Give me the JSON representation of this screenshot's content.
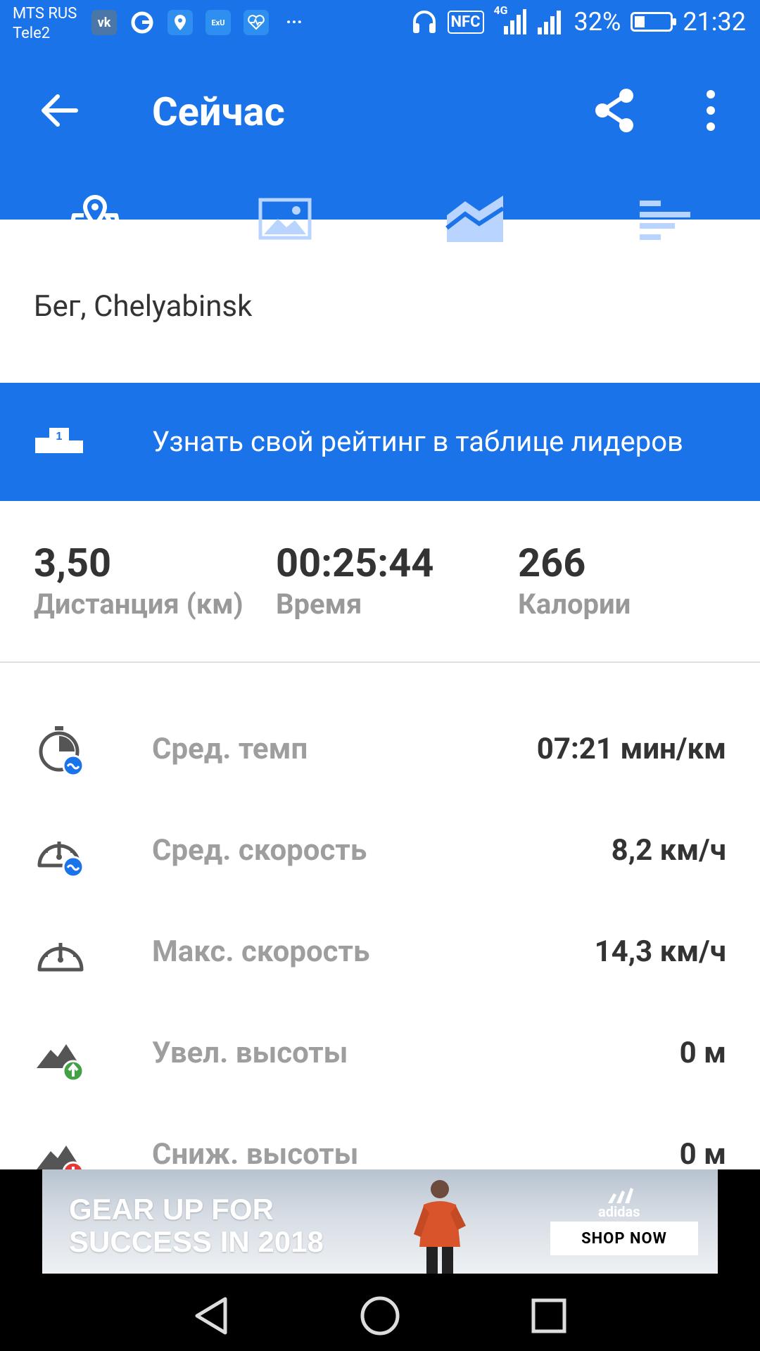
{
  "status_bar": {
    "carrier_1": "MTS RUS",
    "carrier_2": "Tele2",
    "net_type": "4G",
    "nfc": "NFC",
    "battery_pct": "32%",
    "battery_level": 0.32,
    "time": "21:32",
    "app_icons": [
      "vk-icon",
      "google-icon",
      "maps-pin-icon",
      "app-icon",
      "health-icon",
      "more-dots-icon"
    ]
  },
  "app_bar": {
    "title": "Сейчас",
    "tabs": [
      {
        "name": "map",
        "icon": "map-icon",
        "active": true
      },
      {
        "name": "photos",
        "icon": "image-icon",
        "active": false
      },
      {
        "name": "charts",
        "icon": "chart-icon",
        "active": false
      },
      {
        "name": "splits",
        "icon": "splits-icon",
        "active": false
      }
    ]
  },
  "activity": {
    "location": "Бег, Chelyabinsk"
  },
  "leaderboard": {
    "badge_number": "1",
    "text": "Узнать свой рейтинг в таблице лидеров"
  },
  "summary": {
    "distance": {
      "value": "3,50",
      "label": "Дистанция (км)"
    },
    "time": {
      "value": "00:25:44",
      "label": "Время"
    },
    "calories": {
      "value": "266",
      "label": "Калории"
    }
  },
  "metrics": [
    {
      "label": "Сред. темп",
      "value": "07:21 мин/км",
      "icon": "avg-pace-icon"
    },
    {
      "label": "Сред. скорость",
      "value": "8,2 км/ч",
      "icon": "avg-speed-icon"
    },
    {
      "label": "Макс. скорость",
      "value": "14,3 км/ч",
      "icon": "max-speed-icon"
    },
    {
      "label": "Увел. высоты",
      "value": "0 м",
      "icon": "elevation-gain-icon"
    },
    {
      "label": "Сниж. высоты",
      "value": "0 м",
      "icon": "elevation-loss-icon"
    }
  ],
  "ad": {
    "headline_1": "GEAR UP FOR",
    "headline_2": "SUCCESS IN 2018",
    "brand": "adidas",
    "cta": "SHOP NOW"
  },
  "colors": {
    "primary": "#1a73e8",
    "gain_green": "#43a047",
    "loss_red": "#e53935",
    "badge_blue": "#1a73e8"
  }
}
